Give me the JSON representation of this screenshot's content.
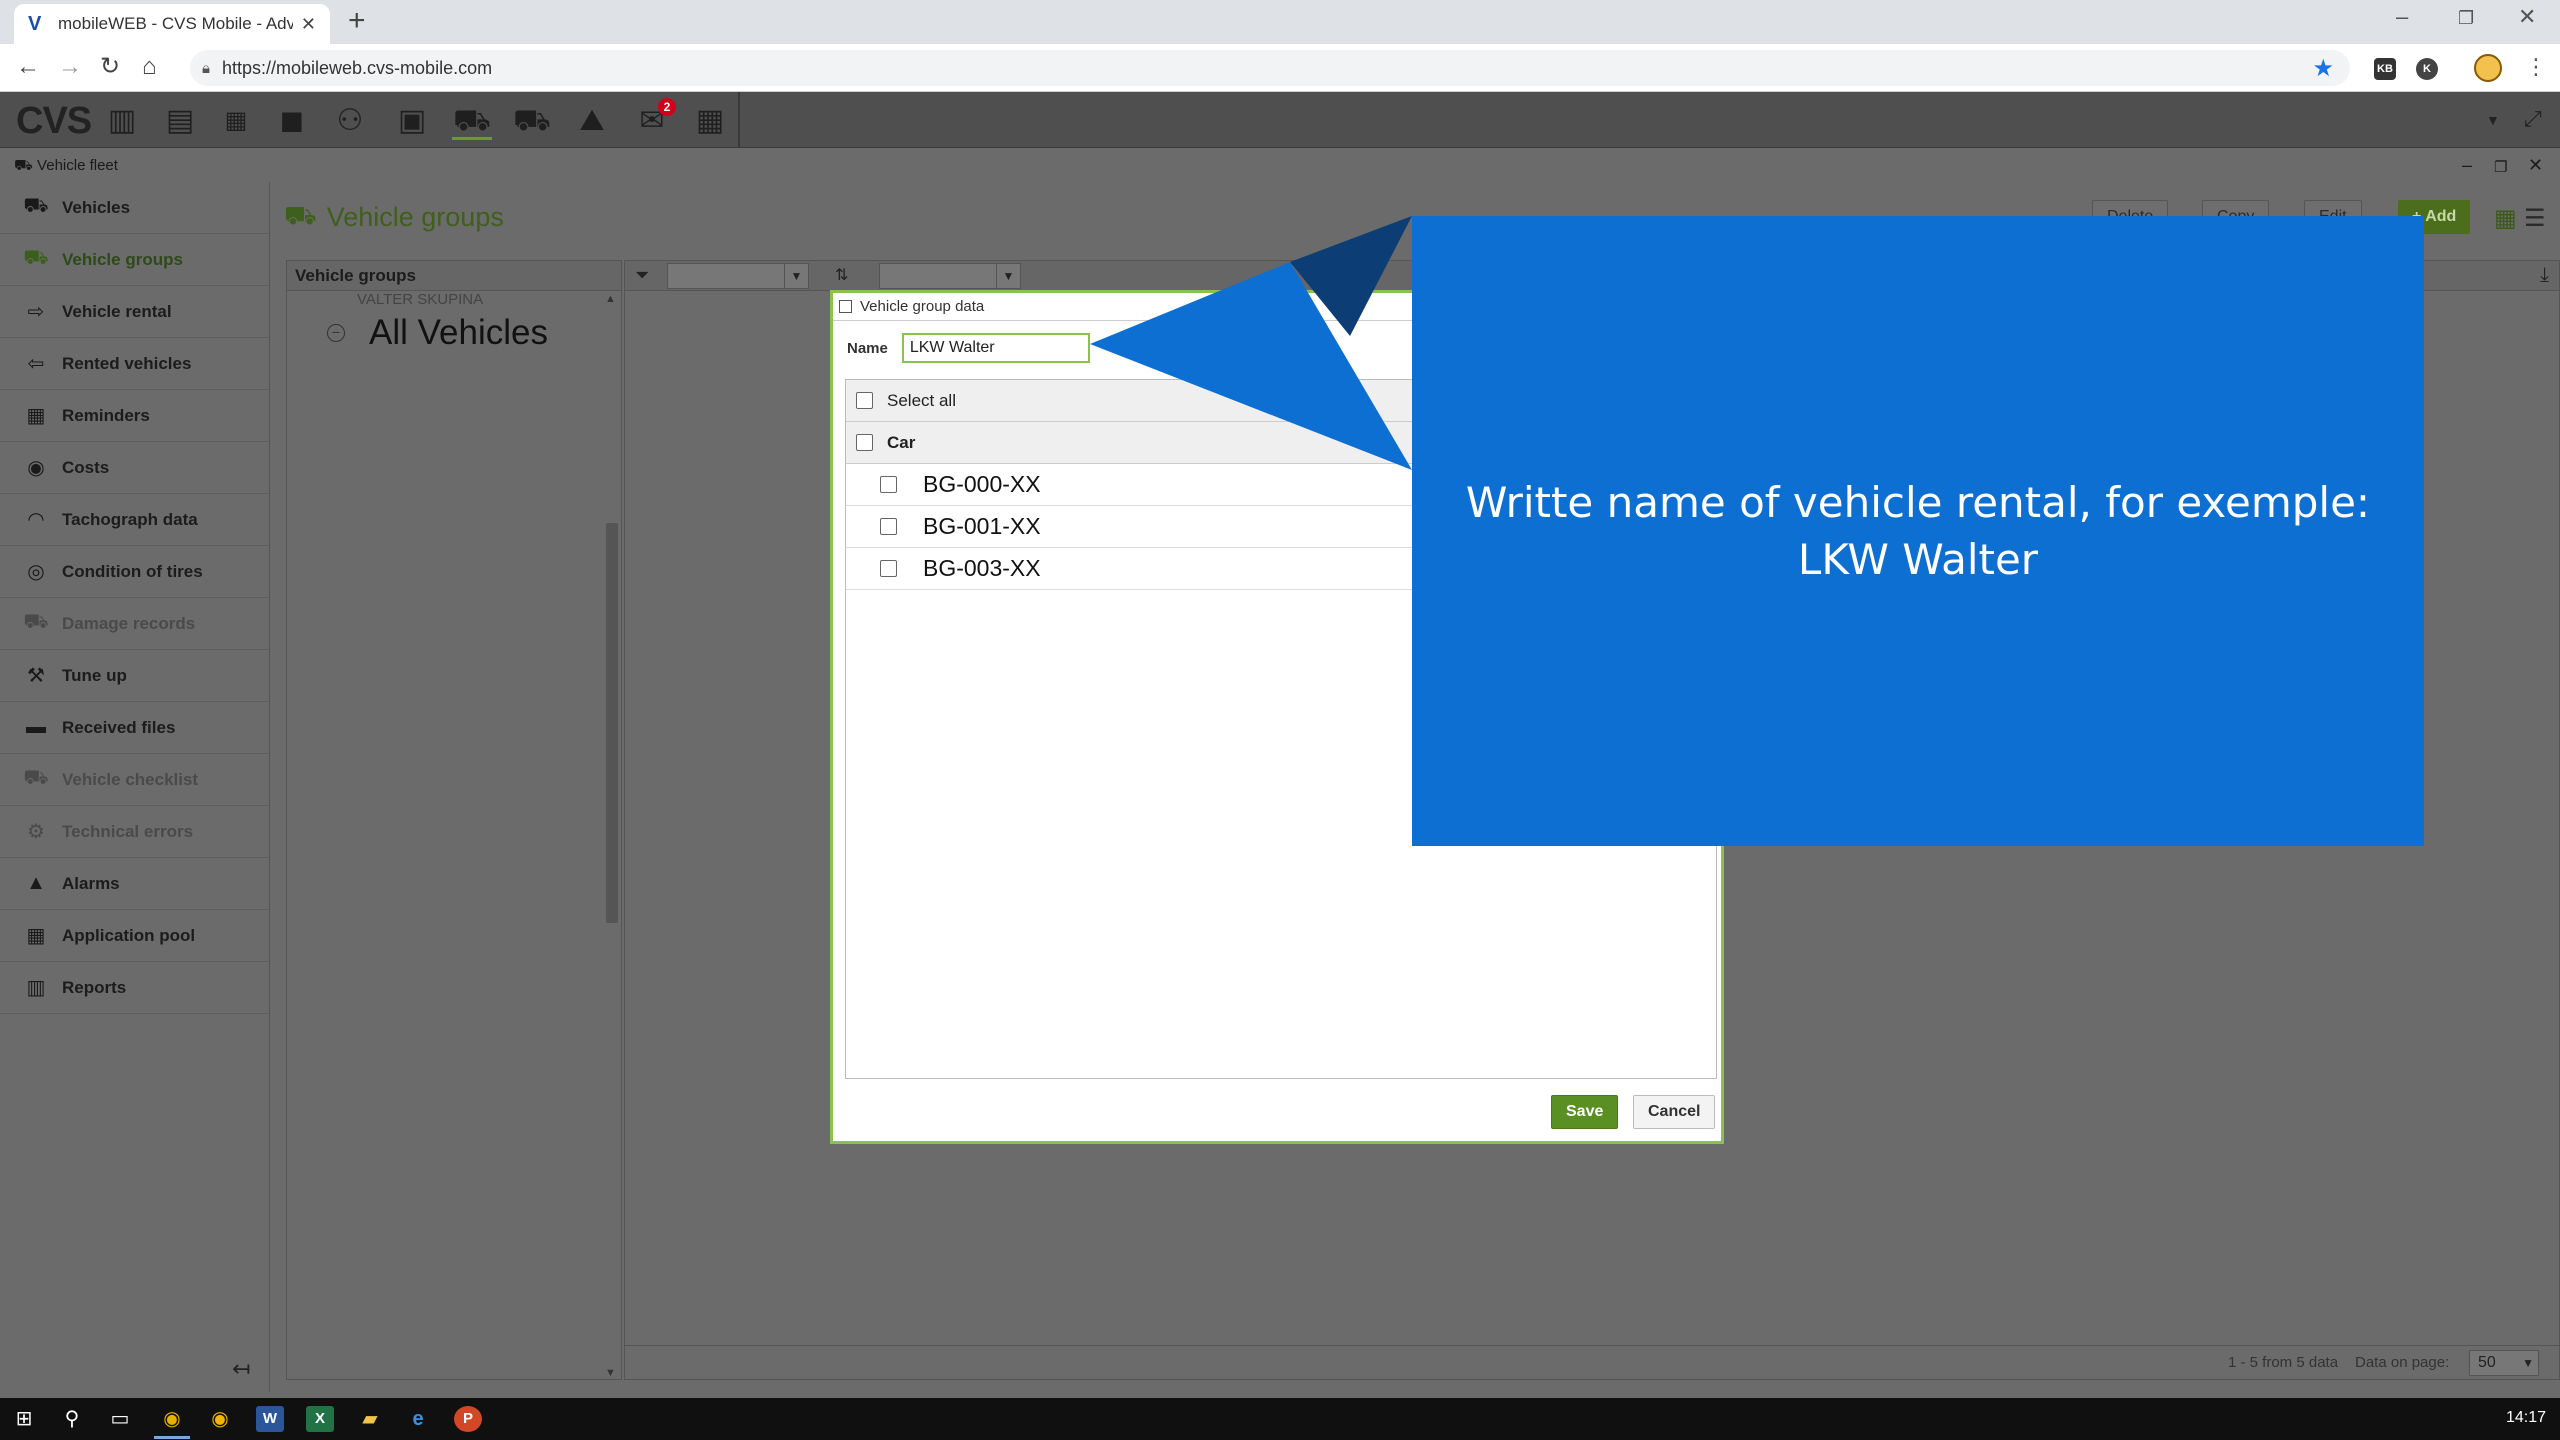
{
  "browser": {
    "tab_title": "mobileWEB - CVS Mobile - Advanced",
    "url": "https://mobileweb.cvs-mobile.com",
    "extensions": [
      "KB",
      "K"
    ]
  },
  "app": {
    "logo": "CVS",
    "messages_badge": "2"
  },
  "module": {
    "title": "Vehicle fleet"
  },
  "sidebar": {
    "items": [
      {
        "label": "Vehicles",
        "icon": "car-icon",
        "state": "normal"
      },
      {
        "label": "Vehicle groups",
        "icon": "cars-icon",
        "state": "active"
      },
      {
        "label": "Vehicle rental",
        "icon": "car-arrow-icon",
        "state": "normal"
      },
      {
        "label": "Rented vehicles",
        "icon": "car-return-icon",
        "state": "normal"
      },
      {
        "label": "Reminders",
        "icon": "calendar-icon",
        "state": "normal"
      },
      {
        "label": "Costs",
        "icon": "coin-icon",
        "state": "normal"
      },
      {
        "label": "Tachograph data",
        "icon": "gauge-icon",
        "state": "normal"
      },
      {
        "label": "Condition of tires",
        "icon": "tire-icon",
        "state": "normal"
      },
      {
        "label": "Damage records",
        "icon": "damaged-car-icon",
        "state": "disabled"
      },
      {
        "label": "Tune up",
        "icon": "wrench-icon",
        "state": "normal"
      },
      {
        "label": "Received files",
        "icon": "folder-icon",
        "state": "normal"
      },
      {
        "label": "Vehicle checklist",
        "icon": "checklist-car-icon",
        "state": "disabled"
      },
      {
        "label": "Technical errors",
        "icon": "engine-icon",
        "state": "disabled"
      },
      {
        "label": "Alarms",
        "icon": "bell-icon",
        "state": "normal"
      },
      {
        "label": "Application pool",
        "icon": "grid-icon",
        "state": "normal"
      },
      {
        "label": "Reports",
        "icon": "bar-chart-icon",
        "state": "normal"
      }
    ]
  },
  "main": {
    "page_title": "Vehicle groups",
    "actions": {
      "delete": "Delete",
      "copy": "Copy",
      "edit": "Edit",
      "add": "+ Add"
    },
    "tree": {
      "header": "Vehicle groups",
      "subitem": "VALTER SKUPINA",
      "root": "All Vehicles"
    },
    "footer": {
      "info": "1 - 5 from 5 data",
      "page_size_label": "Data on page:",
      "page_size": "50"
    }
  },
  "dialog": {
    "title": "Vehicle group data",
    "name_label": "Name",
    "name_value": "LKW Walter",
    "select_all": "Select all",
    "group": "Car",
    "vehicles": [
      "BG-000-XX",
      "BG-001-XX",
      "BG-003-XX"
    ],
    "save": "Save",
    "cancel": "Cancel"
  },
  "callout": {
    "text": "Writte name of vehicle rental, for exemple: LKW Walter",
    "color": "#0d6fd2"
  },
  "taskbar": {
    "clock": "14:17"
  }
}
